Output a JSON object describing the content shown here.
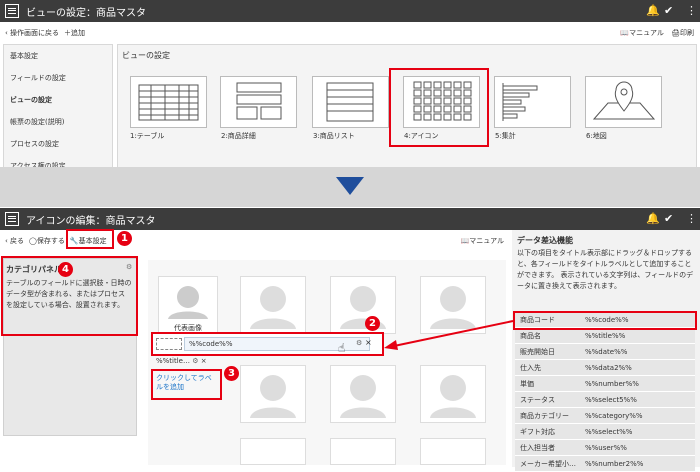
{
  "top": {
    "title": "ビューの設定：商品マスタ",
    "back_label": "操作画面に戻る",
    "add_label": "追加",
    "manual_label": "マニュアル",
    "print_label": "印刷",
    "menu": [
      "基本設定",
      "フィールドの設定",
      "ビューの設定",
      "帳票の設定(説明)",
      "プロセスの設定",
      "アクセス権の設定"
    ],
    "section_title": "ビューの設定",
    "views": [
      "1:テーブル",
      "2:商品詳細",
      "3:商品リスト",
      "4:アイコン",
      "5:集計",
      "6:地図"
    ]
  },
  "bottom": {
    "title": "アイコンの編集：商品マスタ",
    "back_label": "戻る",
    "save_label": "保存する",
    "basic_label": "基本設定",
    "manual_label": "マニュアル",
    "category_title": "カテゴリパネル",
    "category_desc": "テーブルのフィールドに選択肢・日時の データ型が含まれる、またはプロセス を設定している場合、設置されます。",
    "rep_image": "代表画像",
    "code_token": "%%code%%",
    "title_token": "%%title…",
    "add_label_link": "クリックしてラベルを追加",
    "right_title": "データ差込機能",
    "right_desc": "以下の項目をタイトル表示部にドラッグ＆ドロップすると、各フィールドをタイトルラベルとして追加することができます。 表示されている文字列は、フィールドのデータに置き換えて表示されます。",
    "fields": [
      {
        "k": "商品コード",
        "v": "%%code%%"
      },
      {
        "k": "商品名",
        "v": "%%title%%"
      },
      {
        "k": "販売開始日",
        "v": "%%date%%"
      },
      {
        "k": "仕入先",
        "v": "%%data2%%"
      },
      {
        "k": "単価",
        "v": "%%number%%"
      },
      {
        "k": "ステータス",
        "v": "%%select5%%"
      },
      {
        "k": "商品カテゴリー",
        "v": "%%category%%"
      },
      {
        "k": "ギフト対応",
        "v": "%%select%%"
      },
      {
        "k": "仕入担当者",
        "v": "%%user%%"
      },
      {
        "k": "メーカー希望小…",
        "v": "%%number2%%"
      }
    ]
  },
  "badges": [
    "1",
    "2",
    "3",
    "4"
  ],
  "colors": {
    "accent": "#e60012",
    "dark": "#3c3c3c",
    "arrow": "#1f4e9c",
    "link": "#1a73c8"
  }
}
